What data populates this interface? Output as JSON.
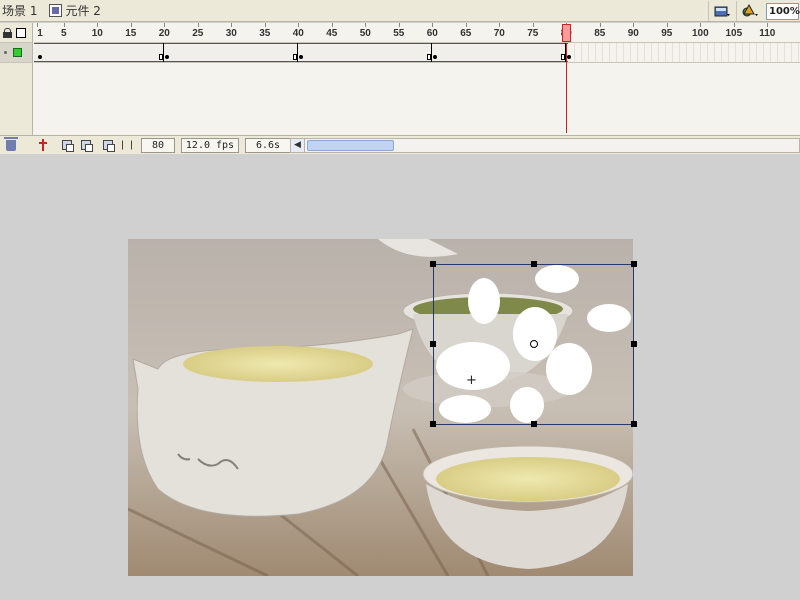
{
  "breadcrumb": {
    "scene_label": "场景 1",
    "symbol_label": "元件 2"
  },
  "toolbar": {
    "edit_scene_icon": "scene-icon",
    "edit_symbol_icon": "symbol-icon",
    "zoom_value": "100%"
  },
  "timeline": {
    "ruler_labels": [
      "1",
      "5",
      "10",
      "15",
      "20",
      "25",
      "30",
      "35",
      "40",
      "45",
      "50",
      "55",
      "60",
      "65",
      "70",
      "75",
      "80",
      "85",
      "90",
      "95",
      "100",
      "105",
      "110"
    ],
    "current_frame": 80,
    "keyframes": [
      1,
      20,
      40,
      60,
      80
    ],
    "footer": {
      "frame": "80",
      "fps": "12.0 fps",
      "time": "6.6s"
    }
  },
  "colors": {
    "playhead": "#cc2222",
    "layer_color": "#33cc33",
    "stage_bg": "#d0d0d0"
  }
}
